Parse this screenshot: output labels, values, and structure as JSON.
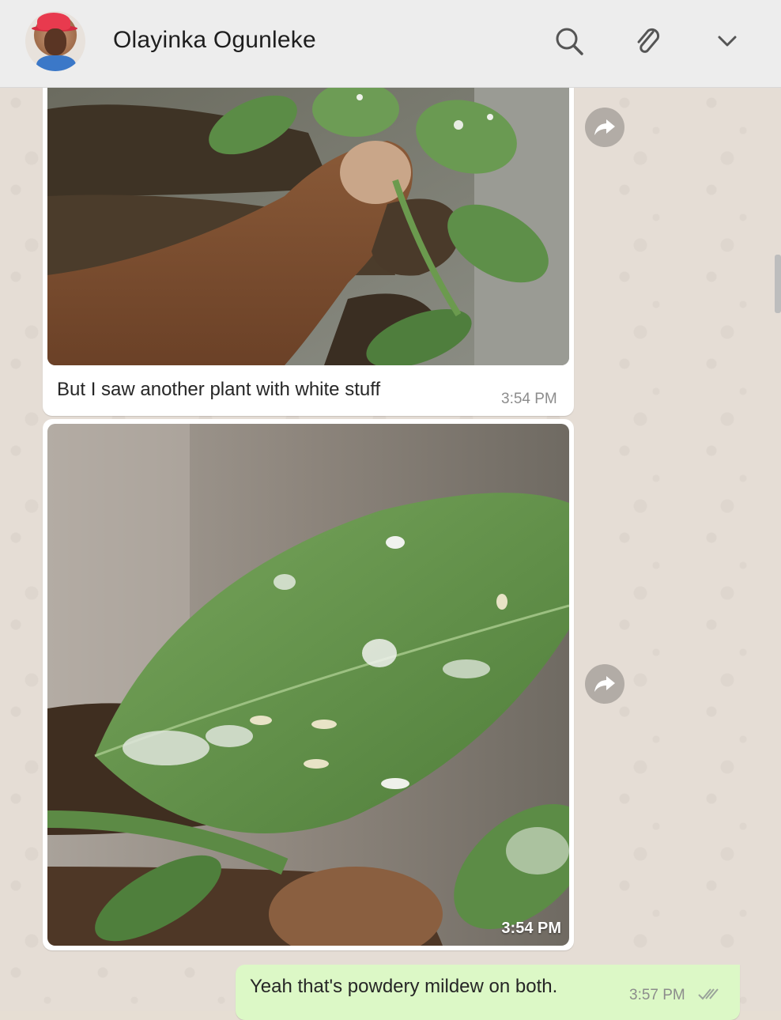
{
  "header": {
    "contact_name": "Olayinka Ogunleke",
    "icons": [
      "search-icon",
      "paperclip-icon",
      "chevron-down-icon"
    ]
  },
  "messages": [
    {
      "type": "image",
      "direction": "incoming",
      "caption": "But I saw another plant with white stuff",
      "time": "3:54 PM"
    },
    {
      "type": "image",
      "direction": "incoming",
      "time": "3:54 PM"
    },
    {
      "type": "text",
      "direction": "outgoing",
      "text": "Yeah that's powdery mildew on both.",
      "time": "3:57 PM",
      "status": "double-check-icon"
    }
  ],
  "colors": {
    "header_bg": "#ededed",
    "chat_bg": "#e5ddd5",
    "outgoing_bubble": "#dcf8c6",
    "incoming_bubble": "#ffffff"
  }
}
